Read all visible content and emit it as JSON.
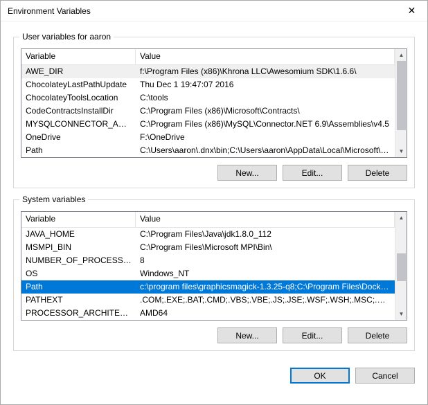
{
  "window": {
    "title": "Environment Variables",
    "close_glyph": "✕"
  },
  "userSection": {
    "label": "User variables for aaron",
    "headers": {
      "variable": "Variable",
      "value": "Value"
    },
    "rows": [
      {
        "name": "AWE_DIR",
        "value": "f:\\Program Files (x86)\\Khrona LLC\\Awesomium SDK\\1.6.6\\",
        "selected": true
      },
      {
        "name": "ChocolateyLastPathUpdate",
        "value": "Thu Dec  1 19:47:07 2016"
      },
      {
        "name": "ChocolateyToolsLocation",
        "value": "C:\\tools"
      },
      {
        "name": "CodeContractsInstallDir",
        "value": "C:\\Program Files (x86)\\Microsoft\\Contracts\\"
      },
      {
        "name": "MYSQLCONNECTOR_ASSE…",
        "value": "C:\\Program Files (x86)\\MySQL\\Connector.NET 6.9\\Assemblies\\v4.5"
      },
      {
        "name": "OneDrive",
        "value": "F:\\OneDrive"
      },
      {
        "name": "Path",
        "value": "C:\\Users\\aaron\\.dnx\\bin;C:\\Users\\aaron\\AppData\\Local\\Microsoft\\…"
      }
    ],
    "buttons": {
      "new": "New...",
      "edit": "Edit...",
      "delete": "Delete"
    }
  },
  "systemSection": {
    "label": "System variables",
    "headers": {
      "variable": "Variable",
      "value": "Value"
    },
    "rows": [
      {
        "name": "JAVA_HOME",
        "value": "C:\\Program Files\\Java\\jdk1.8.0_112"
      },
      {
        "name": "MSMPI_BIN",
        "value": "C:\\Program Files\\Microsoft MPI\\Bin\\"
      },
      {
        "name": "NUMBER_OF_PROCESSORS",
        "value": "8"
      },
      {
        "name": "OS",
        "value": "Windows_NT"
      },
      {
        "name": "Path",
        "value": "c:\\program files\\graphicsmagick-1.3.25-q8;C:\\Program Files\\Docke…",
        "selectedBlue": true
      },
      {
        "name": "PATHEXT",
        "value": ".COM;.EXE;.BAT;.CMD;.VBS;.VBE;.JS;.JSE;.WSF;.WSH;.MSC;.RB;.RBW"
      },
      {
        "name": "PROCESSOR_ARCHITECTURE",
        "value": "AMD64"
      }
    ],
    "buttons": {
      "new": "New...",
      "edit": "Edit...",
      "delete": "Delete"
    }
  },
  "dialogButtons": {
    "ok": "OK",
    "cancel": "Cancel"
  }
}
